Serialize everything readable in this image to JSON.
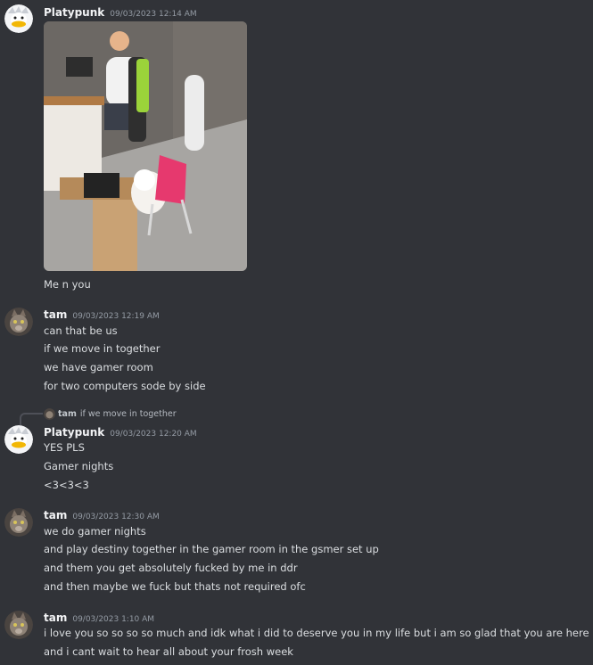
{
  "messages": [
    {
      "username": "Platypunk",
      "timestamp": "09/03/2023 12:14 AM",
      "avatar": "duck-avatar",
      "attachment": "photo-gamer-and-cat",
      "lines": [
        "Me n you"
      ]
    },
    {
      "username": "tam",
      "timestamp": "09/03/2023 12:19 AM",
      "avatar": "cat-avatar",
      "lines": [
        "can that be us",
        "if we move in together",
        "we have gamer room",
        "for two computers sode by side"
      ]
    },
    {
      "username": "Platypunk",
      "timestamp": "09/03/2023 12:20 AM",
      "avatar": "duck-avatar",
      "reply": {
        "username": "tam",
        "text": "if we move in together"
      },
      "lines": [
        "YES PLS",
        "Gamer nights",
        "<3<3<3"
      ]
    },
    {
      "username": "tam",
      "timestamp": "09/03/2023 12:30 AM",
      "avatar": "cat-avatar",
      "lines": [
        "we do gamer nights",
        "and play destiny together in the gamer room in the gsmer set up",
        "and them you get absolutely fucked by me in ddr",
        "and then maybe we fuck but thats not required ofc"
      ]
    },
    {
      "username": "tam",
      "timestamp": "09/03/2023 1:10 AM",
      "avatar": "cat-avatar",
      "lines": [
        "i love you so so so so much and idk what i did to deserve you in my life but i am so glad that you are here",
        "and i cant wait to hear all about your frosh week"
      ]
    }
  ],
  "colors": {
    "background": "#313338",
    "username": "#f2f3f5",
    "text": "#dbdee1",
    "timestamp": "#949ba4"
  }
}
